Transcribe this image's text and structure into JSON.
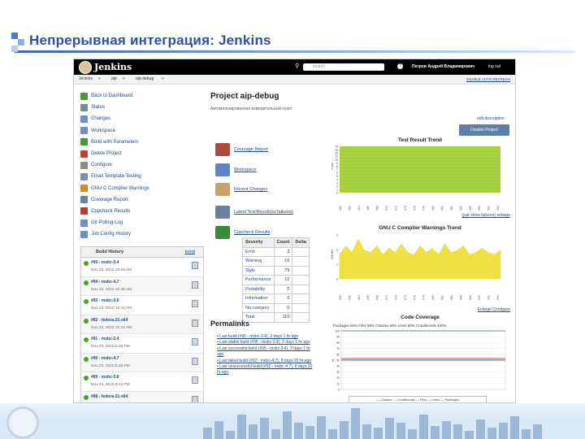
{
  "slide_title": "Непрерывная интеграция: Jenkins",
  "jenkins": {
    "logo_text": "Jenkins",
    "search_placeholder": "search",
    "user": "Петров Андрей Владимирович",
    "logout": "log out",
    "breadcrumbs": [
      "Jenkins",
      "»",
      "aip",
      "»",
      "aip-debug",
      "»"
    ],
    "auto_refresh": "ENABLE AUTO REFRESH"
  },
  "sidebar": {
    "items": [
      {
        "label": "Back to Dashboard",
        "icon": "up-arrow-icon",
        "color": "#4a9a3a"
      },
      {
        "label": "Status",
        "icon": "search-icon",
        "color": "#7a8a99"
      },
      {
        "label": "Changes",
        "icon": "notepad-icon",
        "color": "#6d8fc2"
      },
      {
        "label": "Workspace",
        "icon": "folder-icon",
        "color": "#6d8fc2"
      },
      {
        "label": "Build with Parameters",
        "icon": "clock-icon",
        "color": "#4a9a3a"
      },
      {
        "label": "Delete Project",
        "icon": "no-entry-icon",
        "color": "#d9342b"
      },
      {
        "label": "Configure",
        "icon": "wrench-icon",
        "color": "#8a8a8a"
      },
      {
        "label": "Email Template Testing",
        "icon": "email-icon",
        "color": "#7a8fb0"
      },
      {
        "label": "GNU C Compiler Warnings",
        "icon": "warning-icon",
        "color": "#d88a1a"
      },
      {
        "label": "Coverage Report",
        "icon": "coverage-icon",
        "color": "#6a7fa8"
      },
      {
        "label": "Cppcheck Results",
        "icon": "cppcheck-icon",
        "color": "#c0392b"
      },
      {
        "label": "Git Polling Log",
        "icon": "log-icon",
        "color": "#6d8fc2"
      },
      {
        "label": "Job Config History",
        "icon": "history-icon",
        "color": "#6d8fc2"
      }
    ]
  },
  "build_history": {
    "title": "Build History",
    "trend": "trend",
    "builds": [
      {
        "number": "#95 - msbc-3.4",
        "date": "Nov 23, 2010 10:53 AM"
      },
      {
        "number": "#94 - msbc-4.7",
        "date": "Nov 23, 2010 10:48 AM"
      },
      {
        "number": "#93 - msbc-3.8",
        "date": "Nov 23, 2010 10:43 AM"
      },
      {
        "number": "#92 - fedora-21-x64",
        "date": "Nov 23, 2010 10:43 AM"
      },
      {
        "number": "#91 - msbc-3.4",
        "date": "Nov 23, 2010 5:38 PM"
      },
      {
        "number": "#90 - msbc-4.7",
        "date": "Nov 23, 2010 5:36 PM"
      },
      {
        "number": "#89 - msbc-3.8",
        "date": "Nov 23, 2010 5:14 PM"
      },
      {
        "number": "#88 - fedora-21-x64",
        "date": "Nov 23, 2010 5:14 PM"
      }
    ]
  },
  "project": {
    "title": "Project aip-debug",
    "description": "Автоматизированная измерительный пункт",
    "edit_description": "edit description",
    "disable_button": "Disable Project"
  },
  "links": [
    {
      "label": "Coverage Report",
      "icon": "coverage-report-icon",
      "color": "#b04a3a"
    },
    {
      "label": "Workspace",
      "icon": "folder-icon",
      "color": "#5d85c8"
    },
    {
      "label": "Recent Changes",
      "icon": "notepad-icon",
      "color": "#c9a26a"
    },
    {
      "label": "Latest Test Result",
      "suffix": "(no failures)",
      "icon": "clipboard-icon",
      "color": "#6d7fa0"
    },
    {
      "label": "Cppcheck Results",
      "icon": "cppcheck-icon",
      "color": "#3a8a3a"
    }
  ],
  "severity_table": {
    "headers": [
      "Severity",
      "Count",
      "Delta"
    ],
    "rows": [
      [
        "Error",
        "3",
        ""
      ],
      [
        "Warning",
        "16",
        ""
      ],
      [
        "Style",
        "79",
        ""
      ],
      [
        "Performance",
        "12",
        ""
      ],
      [
        "Portability",
        "0",
        ""
      ],
      [
        "Information",
        "0",
        ""
      ],
      [
        "No category",
        "0",
        ""
      ],
      [
        "Total",
        "110",
        ""
      ]
    ]
  },
  "permalinks": {
    "title": "Permalinks",
    "items": [
      "Last build (#95 - msbc-3.4), 2 days 1 hr ago",
      "Last stable build (#95 - msbc-3.4), 2 days 1 hr ago",
      "Last successful build (#95 - msbc-3.4), 2 days 1 hr ago",
      "Last failed build (#52 - msbc-4.7), 8 days 20 hr ago",
      "Last unsuccessful build (#52 - msbc-4.7), 8 days 20 hr ago"
    ]
  },
  "charts": {
    "test_trend": {
      "title": "Test Result Trend",
      "links": "(just show failures) enlarge",
      "ylabel": "count",
      "yticks": [
        "0",
        "1",
        "2",
        "3",
        "4",
        "5",
        "6",
        "7",
        "8",
        "9",
        "10",
        "11",
        "12",
        "13",
        "14"
      ],
      "color": "#a4d13a"
    },
    "warnings_trend": {
      "title": "GNU C Compiler Warnings Trend",
      "links": "Enlarge Configure",
      "ylabel": "COUNT",
      "yticks": [
        "0",
        "1",
        "2",
        "3"
      ],
      "color": "#f0e142"
    },
    "coverage": {
      "title": "Code Coverage",
      "header": "Packages 50% Files 50% Classes 50% Lines 50% Conditionals 100%",
      "ylabel": "%",
      "yticks": [
        "0",
        "10",
        "20",
        "30",
        "40",
        "50",
        "60",
        "70",
        "80",
        "90",
        "100"
      ],
      "legend": "— Classes — Conditionals — Files — Lines — Packages"
    }
  }
}
